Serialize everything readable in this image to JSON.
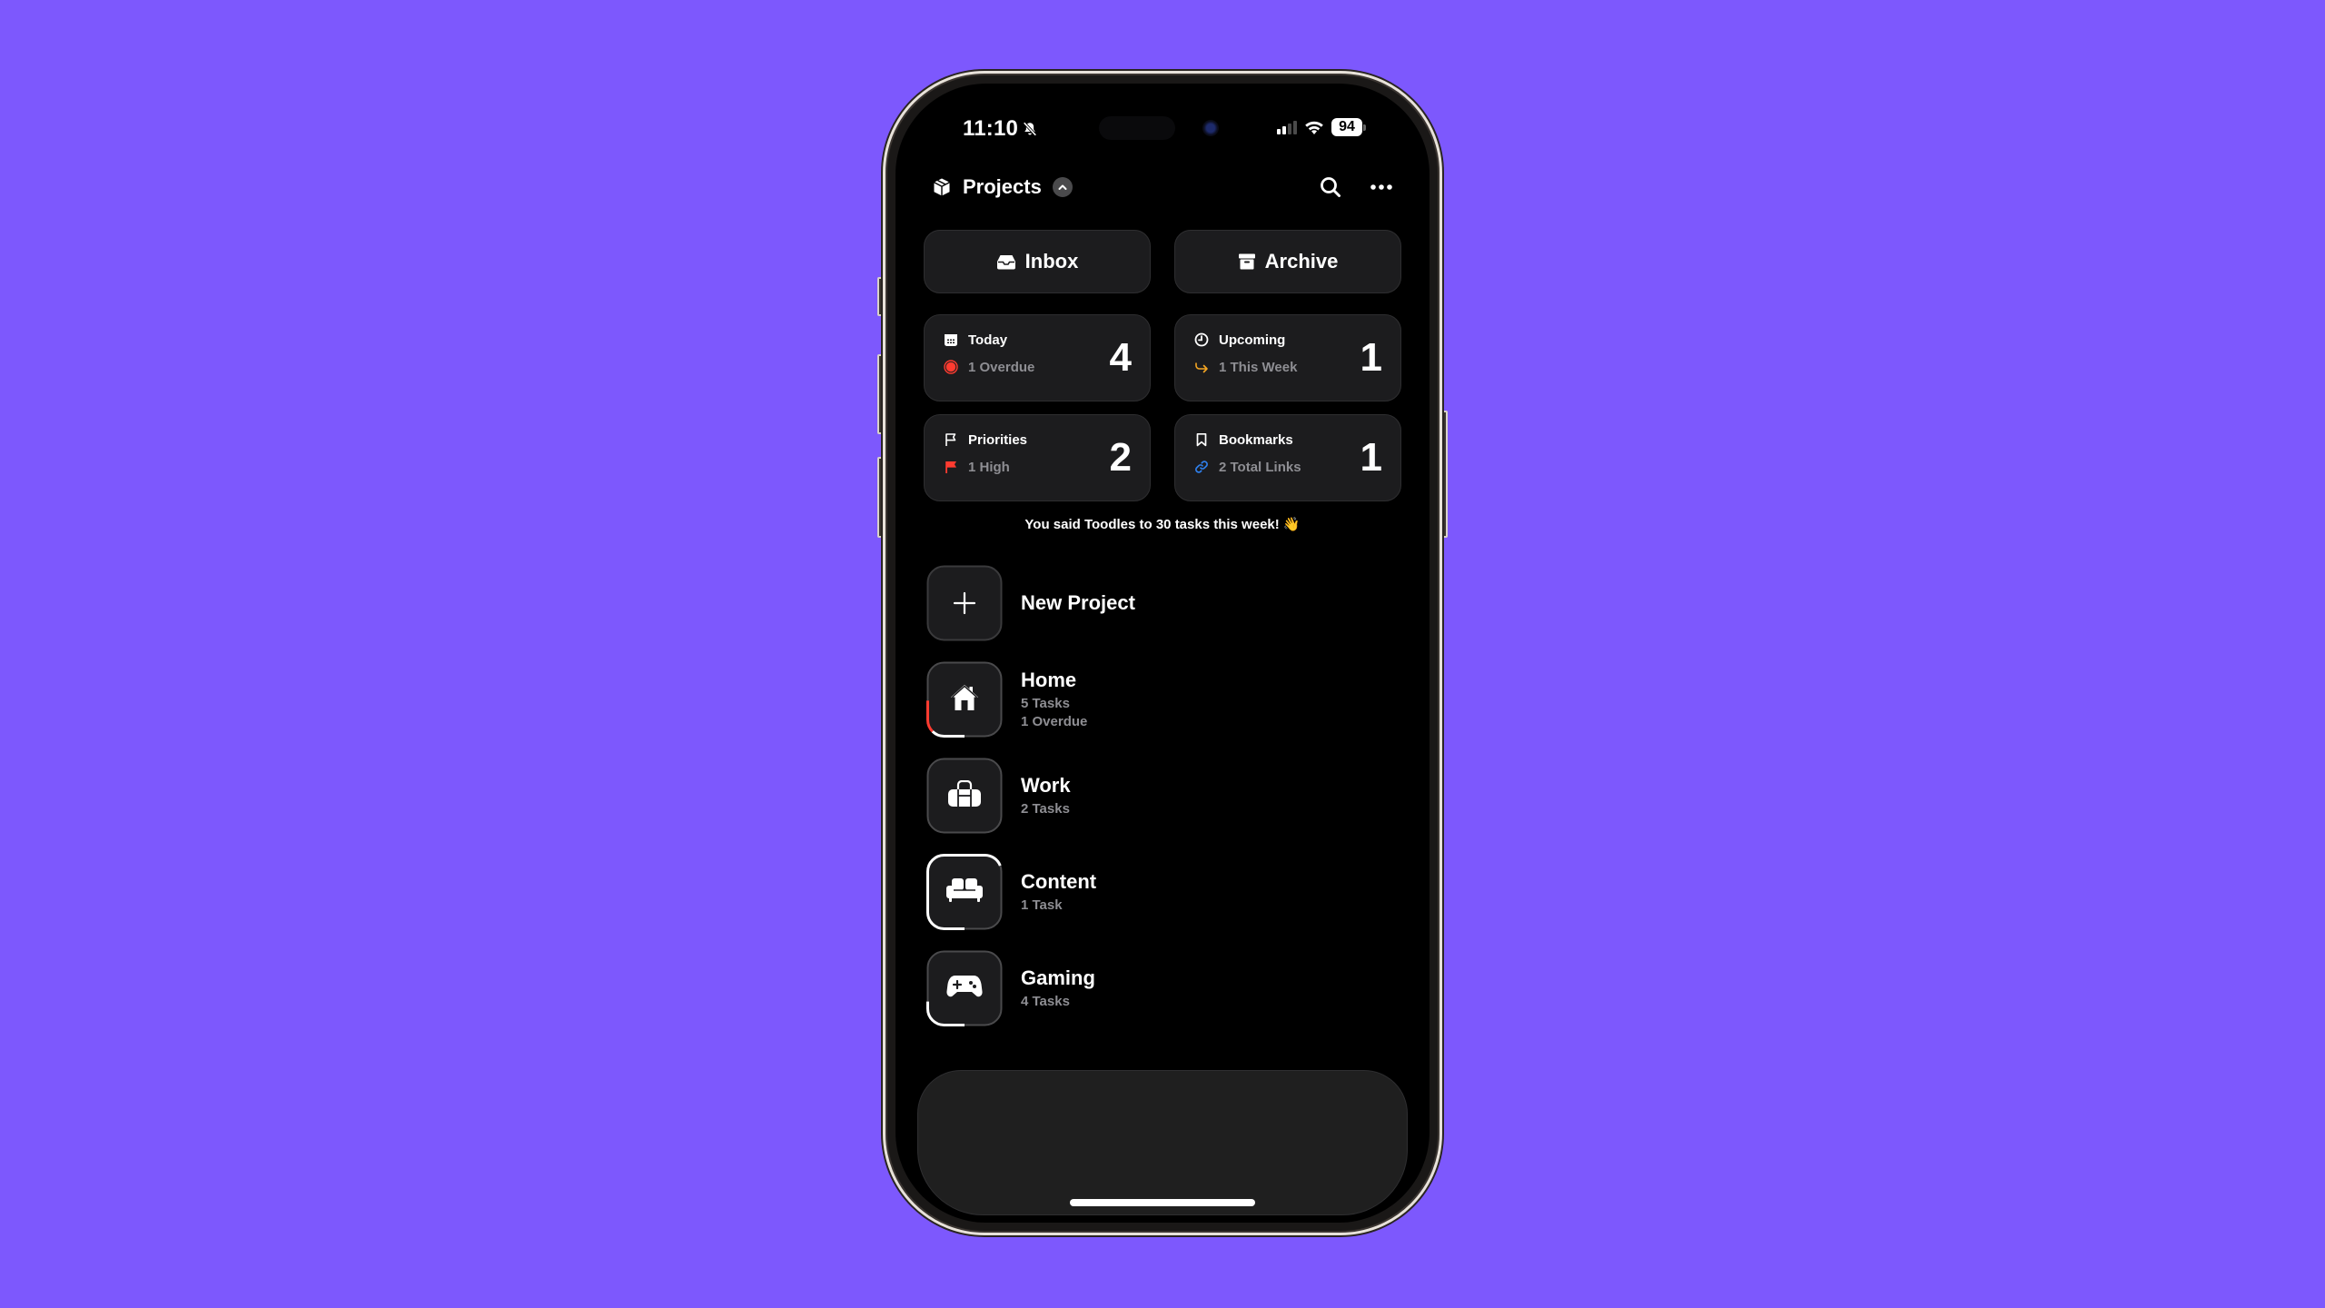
{
  "status_bar": {
    "time": "11:10",
    "silent_icon": "bell-slash-icon",
    "signal_bars_active": 2,
    "signal_bars_total": 4,
    "wifi_icon": "wifi-icon",
    "battery_percent": "94"
  },
  "header": {
    "icon": "shipping-box-icon",
    "title": "Projects",
    "toggle_icon": "chevron-up-icon",
    "search_icon": "search-icon",
    "more_icon": "ellipsis-icon"
  },
  "nav_buttons": [
    {
      "label": "Inbox",
      "icon": "inbox-tray-icon"
    },
    {
      "label": "Archive",
      "icon": "archive-box-icon"
    }
  ],
  "stat_cards": [
    {
      "title": "Today",
      "icon": "calendar-icon",
      "sub_label": "1 Overdue",
      "sub_icon": "overdue-circle-icon",
      "sub_icon_color": "#ff3b30",
      "count": "4"
    },
    {
      "title": "Upcoming",
      "icon": "clock-icon",
      "sub_label": "1 This Week",
      "sub_icon": "arrow-turn-right-icon",
      "sub_icon_color": "#f5a623",
      "count": "1"
    },
    {
      "title": "Priorities",
      "icon": "flag-outline-icon",
      "sub_label": "1 High",
      "sub_icon": "flag-filled-icon",
      "sub_icon_color": "#ff3b30",
      "count": "2"
    },
    {
      "title": "Bookmarks",
      "icon": "bookmark-icon",
      "sub_label": "2 Total Links",
      "sub_icon": "link-icon",
      "sub_icon_color": "#2f80ed",
      "count": "1"
    }
  ],
  "weekly_message": "You said Toodles to 30 tasks this week! 👋",
  "new_project": {
    "label": "New Project",
    "icon": "plus-icon"
  },
  "projects": [
    {
      "name": "Home",
      "icon": "house-icon",
      "meta": [
        "5 Tasks",
        "1 Overdue"
      ],
      "progress": 0.125,
      "overdue_fraction": 0.12
    },
    {
      "name": "Work",
      "icon": "briefcase-icon",
      "meta": [
        "2 Tasks"
      ],
      "progress": 0,
      "overdue_fraction": 0
    },
    {
      "name": "Content",
      "icon": "sofa-icon",
      "meta": [
        "1 Task"
      ],
      "progress": 0.65,
      "overdue_fraction": 0
    },
    {
      "name": "Gaming",
      "icon": "gamepad-icon",
      "meta": [
        "4 Tasks"
      ],
      "progress": 0.2,
      "overdue_fraction": 0
    }
  ],
  "colors": {
    "background": "#7d58fd",
    "card": "#1c1c1e",
    "secondary_text": "#8e8e93",
    "danger": "#ff3b30",
    "warning": "#f5a623",
    "link": "#2f80ed"
  }
}
